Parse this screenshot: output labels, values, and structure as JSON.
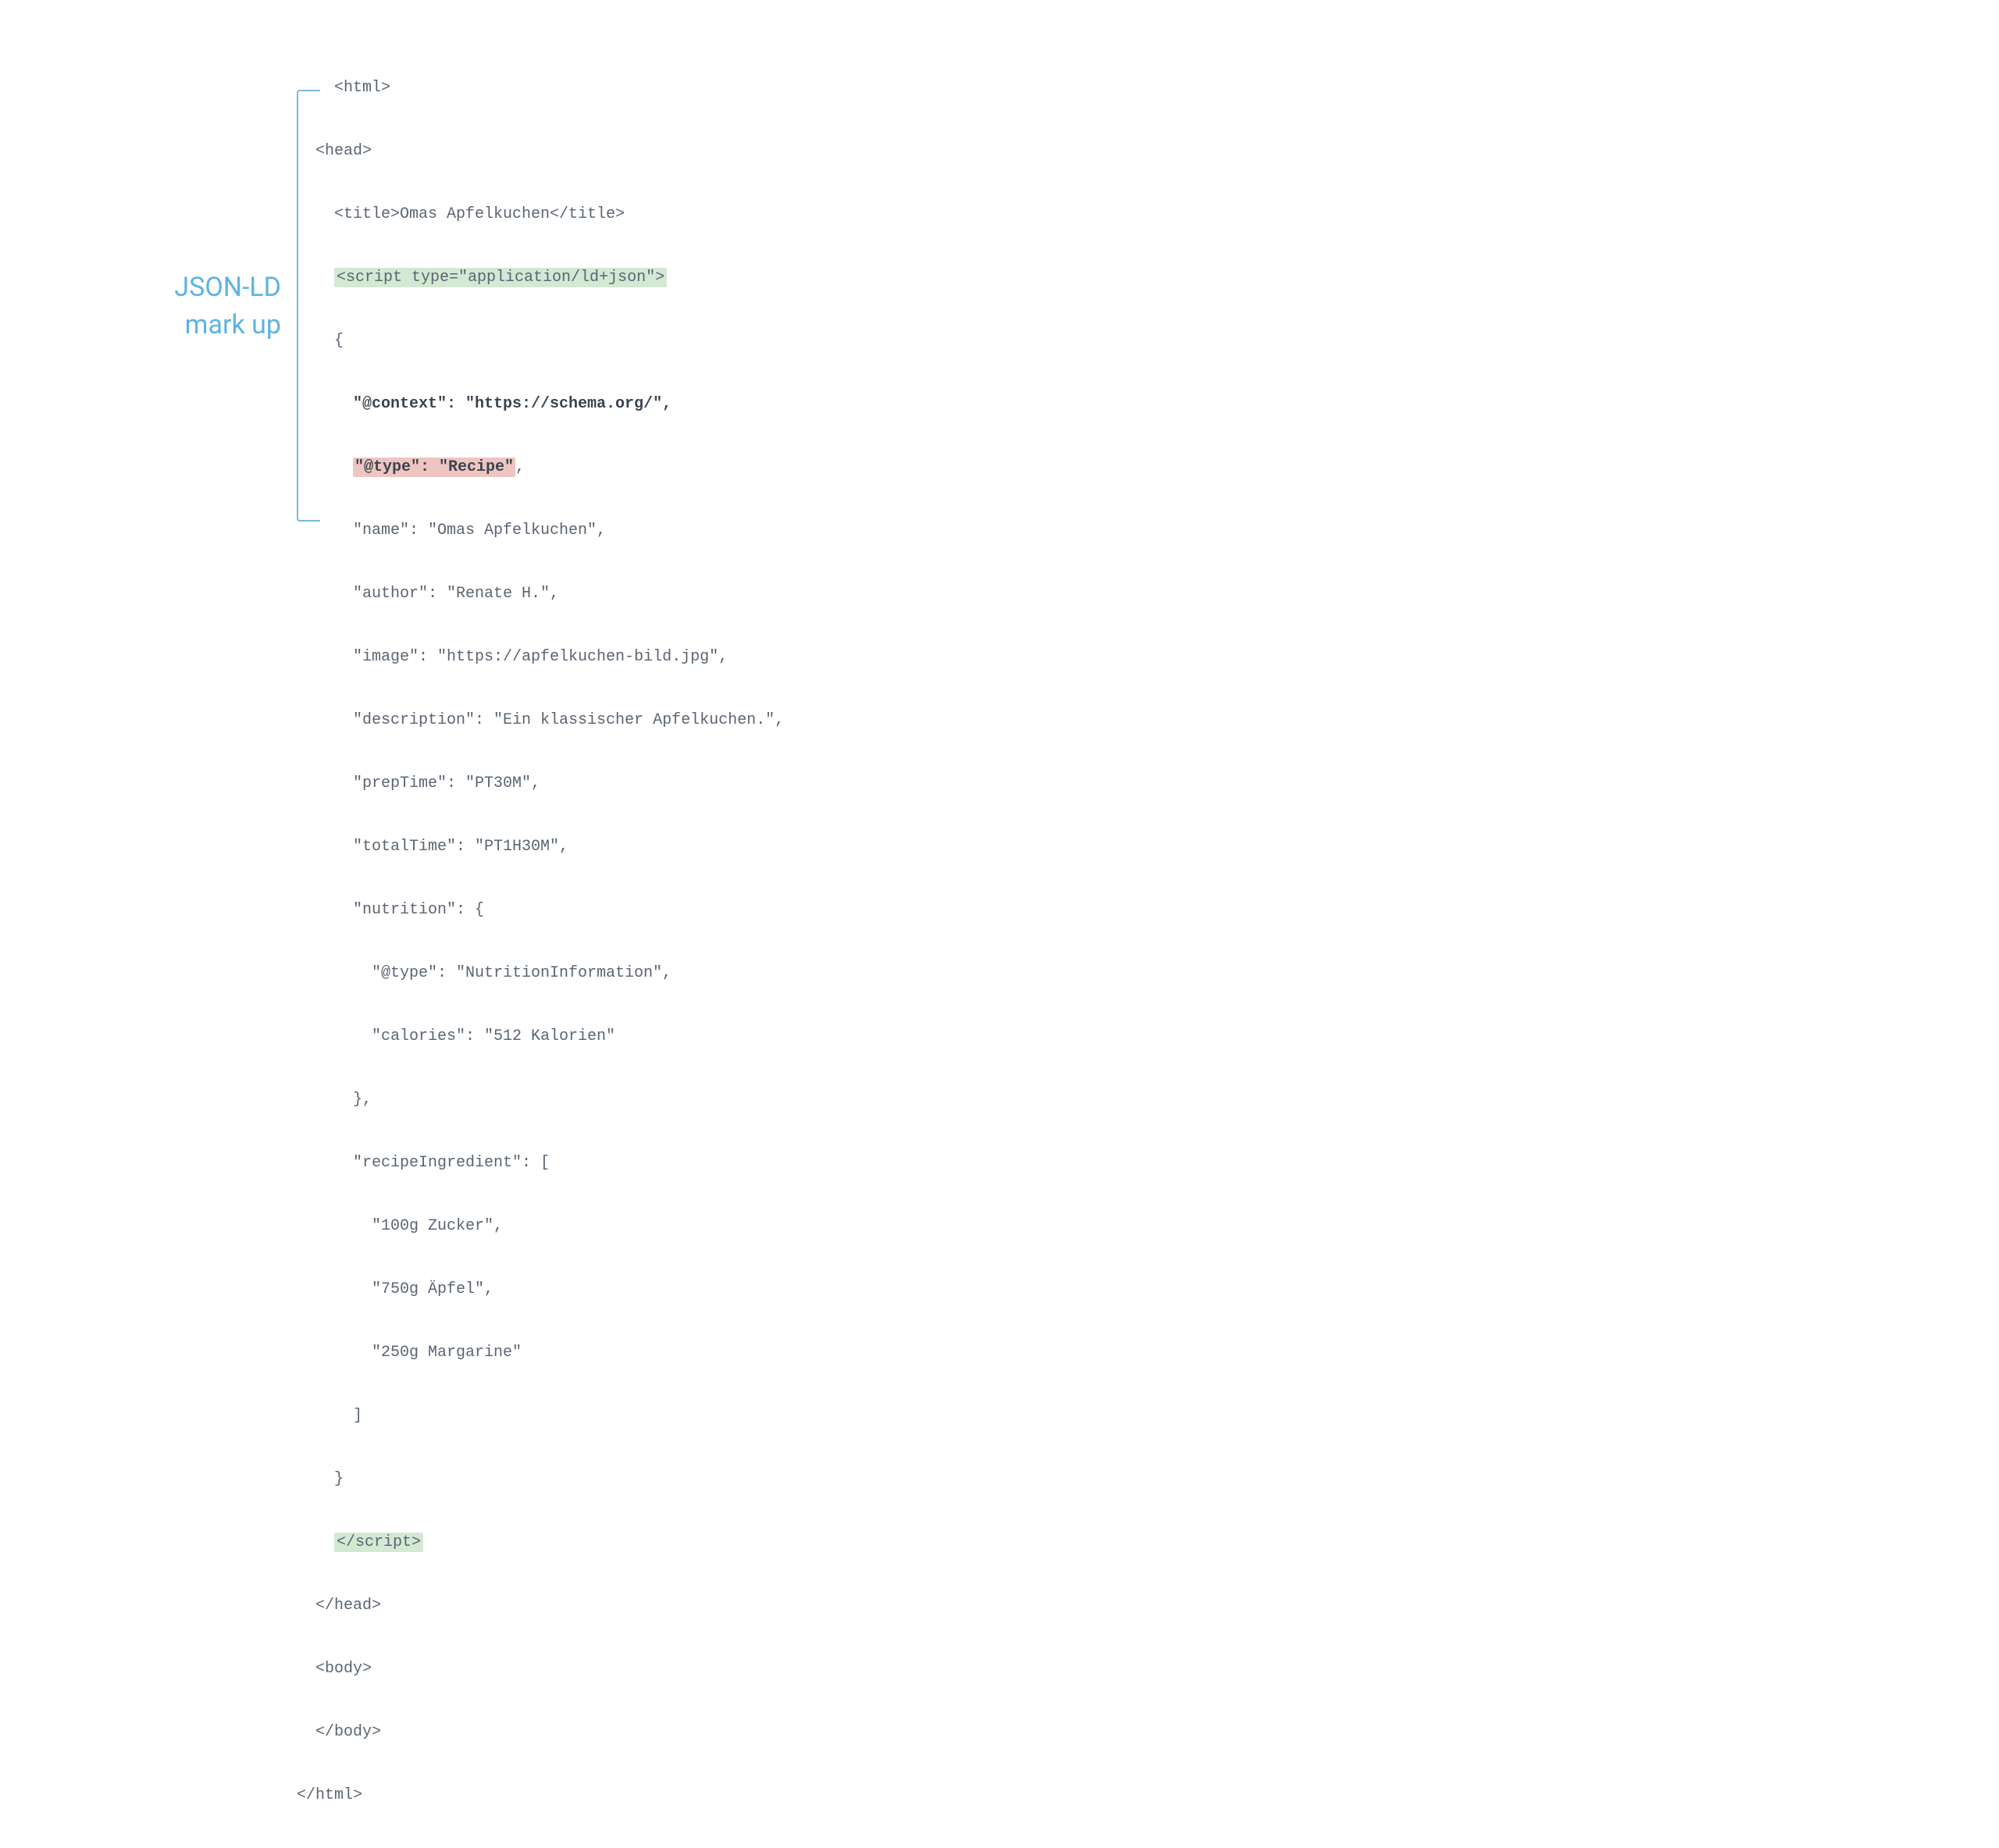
{
  "label": {
    "line1": "JSON-LD",
    "line2": "mark up"
  },
  "code": {
    "line01": "<html>",
    "line02": "<head>",
    "line03a": "<title>",
    "line03b": "Omas Apfelkuchen",
    "line03c": "</title>",
    "line04a": "<script",
    "line04b": " type=\"application/ld+json\">",
    "line05": "{",
    "line06": "\"@context\": \"https://schema.org/\",",
    "line07a": "\"@type\": \"Recipe\"",
    "line07b": ",",
    "line08": "\"name\": \"Omas Apfelkuchen\",",
    "line09": "\"author\": \"Renate H.\",",
    "line10": "\"image\": \"https://apfelkuchen-bild.jpg\",",
    "line11": "\"description\": \"Ein klassischer Apfelkuchen.\",",
    "line12": "\"prepTime\": \"PT30M\",",
    "line13": "\"totalTime\": \"PT1H30M\",",
    "line14": "\"nutrition\": {",
    "line15": "\"@type\": \"NutritionInformation\",",
    "line16": "\"calories\": \"512 Kalorien\"",
    "line17": "},",
    "line18": "\"recipeIngredient\": [",
    "line19": "\"100g Zucker\",",
    "line20": "\"750g Äpfel\",",
    "line21": "\"250g Margarine\"",
    "line22": "]",
    "line23": "}",
    "line24": "</script>",
    "line25": "</head>",
    "line26": "<body>",
    "line27": "</body>",
    "line28": "</html>"
  }
}
